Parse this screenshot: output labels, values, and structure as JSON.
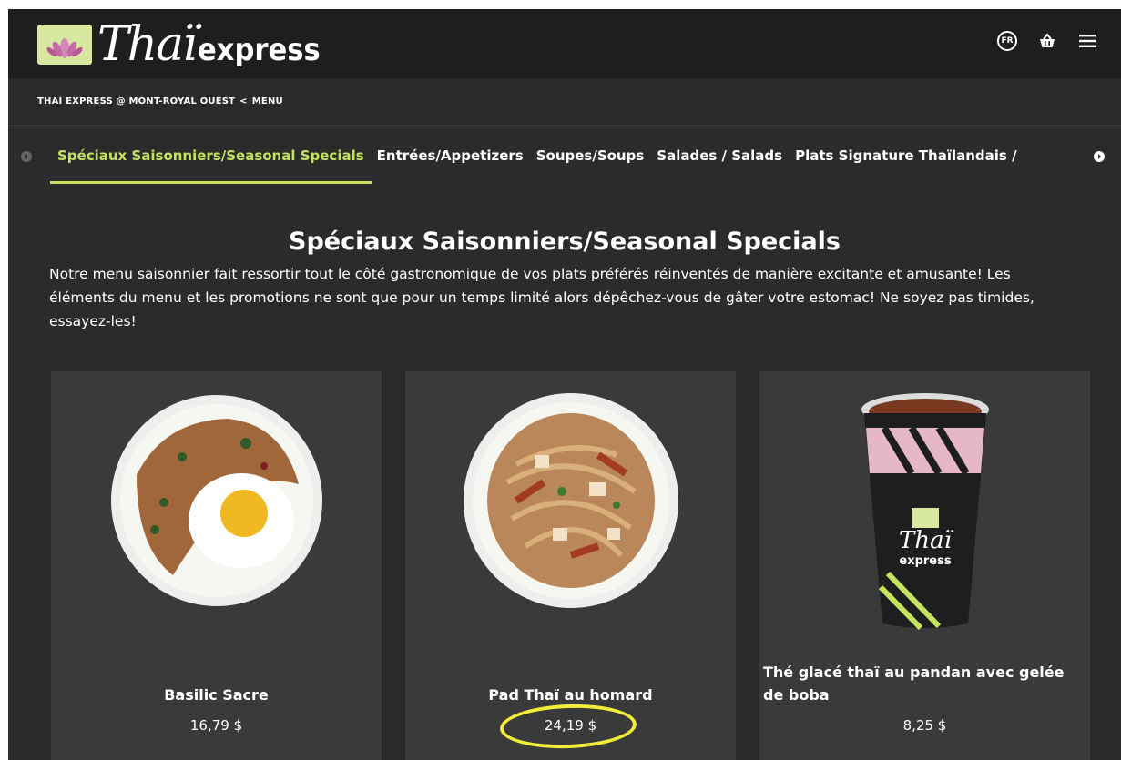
{
  "header": {
    "logo_script": "Thaï",
    "logo_word": "express",
    "lang_button": "FR"
  },
  "breadcrumb": {
    "location": "THAI EXPRESS @ MONT-ROYAL OUEST",
    "separator": "<",
    "current": "MENU"
  },
  "tabs": [
    {
      "label": "Spéciaux Saisonniers/Seasonal Specials",
      "active": true
    },
    {
      "label": "Entrées/Appetizers",
      "active": false
    },
    {
      "label": "Soupes/Soups",
      "active": false
    },
    {
      "label": "Salades / Salads",
      "active": false
    },
    {
      "label": "Plats Signature Thaïlandais /",
      "active": false
    }
  ],
  "section": {
    "title": "Spéciaux Saisonniers/Seasonal Specials",
    "description": "Notre menu saisonnier fait ressortir tout le côté gastronomique de vos plats préférés réinventés de manière excitante et amusante! Les éléments du menu et les promotions ne sont que pour un temps limité alors dépêchez-vous de gâter votre estomac! Ne soyez pas timides, essayez-les!"
  },
  "items": [
    {
      "name": "Basilic Sacre",
      "price": "16,79 $",
      "image": "rice-bowl-with-egg"
    },
    {
      "name": "Pad Thaï au homard",
      "price": "24,19 $",
      "image": "pad-thai-bowl"
    },
    {
      "name": "Thé glacé thaï au pandan avec gelée de boba",
      "price": "8,25 $",
      "image": "iced-tea-cup"
    }
  ],
  "colors": {
    "accent": "#c6e35f",
    "background": "#2b2b2b",
    "header": "#1e1e1e",
    "card": "#3a3a3a",
    "highlight": "#f1ee3a"
  }
}
